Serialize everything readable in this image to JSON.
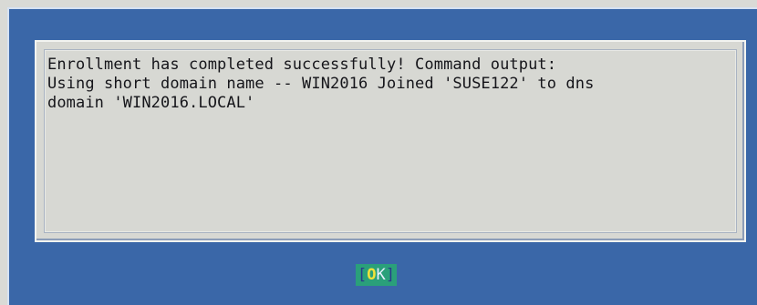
{
  "dialog": {
    "message_lines": [
      "Enrollment has completed successfully! Command output:",
      "Using short domain name -- WIN2016 Joined 'SUSE122' to dns",
      "domain 'WIN2016.LOCAL'"
    ]
  },
  "ok_button": {
    "open_bracket": "[",
    "hotkey": "O",
    "rest": "K",
    "close_bracket": "]"
  },
  "colors": {
    "dialog_background": "#3a67a8",
    "message_background": "#d7d8d3",
    "button_background": "#2aa07a",
    "hotkey": "#f2e23a"
  }
}
